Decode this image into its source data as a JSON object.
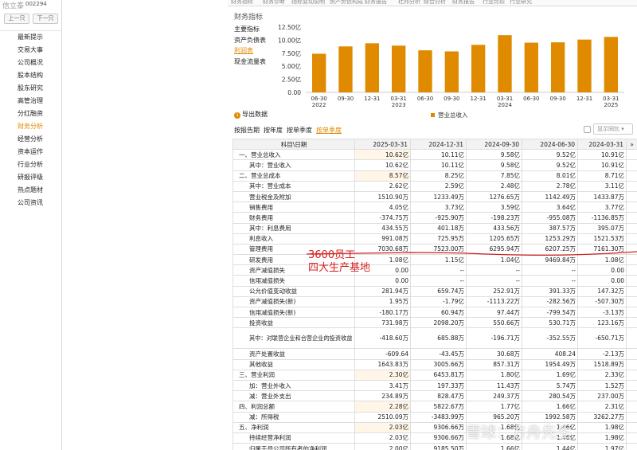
{
  "app": {
    "logo": "信立泰",
    "code": "002294",
    "prev": "上一只",
    "next": "下一只"
  },
  "menu": {
    "items": [
      "最新提示",
      "交易大事",
      "公司概况",
      "股本结构",
      "股东研究",
      "高管治理",
      "分红融资",
      "财务分析",
      "经营分析",
      "资本运作",
      "行业分析",
      "研报评级",
      "热点题材",
      "公司资讯"
    ],
    "active": 7
  },
  "top_tabs": [
    "财务指标",
    "财务诊断",
    "指标变动说明",
    "资产负债构成",
    "财务报告",
    "杜邦分析",
    "综合分析",
    "财务报告",
    "行业比较",
    "行业研究"
  ],
  "section_title": "财务指标",
  "subnav": {
    "items": [
      "主要指标",
      "资产负债表",
      "利润表",
      "现金流量表"
    ],
    "active": 2
  },
  "export_label": "导出数据",
  "views": {
    "items": [
      "按报告期",
      "按年度",
      "按单季度",
      "按单季度"
    ],
    "active": 3
  },
  "compare_label": "显示同比",
  "chart_data": {
    "type": "bar",
    "categories": [
      "06-30\n2022",
      "09-30",
      "12-31",
      "03-31\n2023",
      "06-30",
      "09-30",
      "12-31",
      "03-31\n2024",
      "06-30",
      "09-30",
      "12-31",
      "03-31\n2025"
    ],
    "series": [
      {
        "name": "营业总收入",
        "values": [
          7.4,
          8.8,
          9.4,
          8.95,
          8.05,
          7.85,
          9.1,
          10.95,
          9.52,
          9.58,
          10.11,
          10.62
        ],
        "color": "#e08a00"
      }
    ],
    "yticks": [
      "0.00",
      "2.50亿",
      "5.00亿",
      "7.50亿",
      "10.00亿",
      "12.50亿"
    ],
    "ylim": [
      0,
      12.5
    ]
  },
  "table": {
    "header": [
      "科目\\日期",
      "2025-03-31",
      "2024-12-31",
      "2024-09-30",
      "2024-06-30",
      "2024-03-31"
    ],
    "more": "»",
    "rows": [
      {
        "label": "一、营业总收入",
        "cells": [
          "10.62亿",
          "10.11亿",
          "9.58亿",
          "9.52亿",
          "10.91亿"
        ],
        "ind": 0,
        "hl": 1
      },
      {
        "label": "其中：营业收入",
        "cells": [
          "10.62亿",
          "10.11亿",
          "9.58亿",
          "9.52亿",
          "10.91亿"
        ],
        "ind": 1
      },
      {
        "label": "二、营业总成本",
        "cells": [
          "8.57亿",
          "8.25亿",
          "7.85亿",
          "8.01亿",
          "8.71亿"
        ],
        "ind": 0,
        "hl": 1
      },
      {
        "label": "其中：营业成本",
        "cells": [
          "2.62亿",
          "2.59亿",
          "2.48亿",
          "2.78亿",
          "3.11亿"
        ],
        "ind": 1
      },
      {
        "label": "营业税金及附加",
        "cells": [
          "1510.90万",
          "1233.49万",
          "1276.65万",
          "1142.49万",
          "1433.87万"
        ],
        "ind": 1
      },
      {
        "label": "销售费用",
        "cells": [
          "4.05亿",
          "3.73亿",
          "3.59亿",
          "3.64亿",
          "3.77亿"
        ],
        "ind": 1
      },
      {
        "label": "财务费用",
        "cells": [
          "-374.75万",
          "-925.90万",
          "-198.23万",
          "-955.08万",
          "-1136.85万"
        ],
        "ind": 1
      },
      {
        "label": "其中：利息费用",
        "cells": [
          "434.55万",
          "401.18万",
          "433.56万",
          "387.57万",
          "395.07万"
        ],
        "ind": 1
      },
      {
        "label": "利息收入",
        "cells": [
          "991.08万",
          "725.95万",
          "1205.65万",
          "1253.29万",
          "1521.53万"
        ],
        "ind": 1
      },
      {
        "label": "管理费用",
        "cells": [
          "7030.68万",
          "7523.00万",
          "6295.94万",
          "6207.25万",
          "7161.30万"
        ],
        "ind": 1
      },
      {
        "label": "研发费用",
        "cells": [
          "1.08亿",
          "1.15亿",
          "1.04亿",
          "9469.84万",
          "1.08亿"
        ],
        "ind": 1
      },
      {
        "label": "资产减值损失",
        "cells": [
          "0.00",
          "--",
          "--",
          "--",
          "0.00"
        ],
        "ind": 1
      },
      {
        "label": "信用减值损失",
        "cells": [
          "0.00",
          "--",
          "--",
          "--",
          "0.00"
        ],
        "ind": 1
      },
      {
        "label": "公允价值变动收益",
        "cells": [
          "281.94万",
          "659.74万",
          "252.91万",
          "391.33万",
          "147.32万"
        ],
        "ind": 1
      },
      {
        "label": "资产减值损失(新)",
        "cells": [
          "1.95万",
          "-1.79亿",
          "-1113.22万",
          "-282.56万",
          "-507.30万"
        ],
        "ind": 1
      },
      {
        "label": "信用减值损失(新)",
        "cells": [
          "-180.17万",
          "60.94万",
          "97.44万",
          "-799.54万",
          "-3.13万"
        ],
        "ind": 1
      },
      {
        "label": "投资收益",
        "cells": [
          "731.98万",
          "2098.20万",
          "550.66万",
          "530.71万",
          "123.16万"
        ],
        "ind": 1
      },
      {
        "label": "其中：对联营企业和合营企业的投资收益",
        "cells": [
          "-418.60万",
          "685.88万",
          "-196.71万",
          "-352.55万",
          "-650.71万"
        ],
        "ind": 1,
        "wrap": 1
      },
      {
        "label": "资产处置收益",
        "cells": [
          "-609.64",
          "-43.45万",
          "30.68万",
          "408.24",
          "-2.13万"
        ],
        "ind": 1
      },
      {
        "label": "其他收益",
        "cells": [
          "1643.83万",
          "3005.66万",
          "857.31万",
          "1954.49万",
          "1518.89万"
        ],
        "ind": 1
      },
      {
        "label": "三、营业利润",
        "cells": [
          "2.30亿",
          "6453.81万",
          "1.80亿",
          "1.69亿",
          "2.33亿"
        ],
        "ind": 0,
        "hl": 1
      },
      {
        "label": "加：营业外收入",
        "cells": [
          "3.41万",
          "197.33万",
          "11.43万",
          "5.74万",
          "1.52万"
        ],
        "ind": 1
      },
      {
        "label": "减：营业外支出",
        "cells": [
          "234.89万",
          "828.47万",
          "249.37万",
          "280.54万",
          "237.00万"
        ],
        "ind": 1
      },
      {
        "label": "四、利润总额",
        "cells": [
          "2.28亿",
          "5822.67万",
          "1.77亿",
          "1.66亿",
          "2.31亿"
        ],
        "ind": 0,
        "hl": 1
      },
      {
        "label": "减：所得税",
        "cells": [
          "2510.09万",
          "-3483.99万",
          "965.20万",
          "1992.58万",
          "3262.27万"
        ],
        "ind": 1
      },
      {
        "label": "五、净利润",
        "cells": [
          "2.03亿",
          "9306.66万",
          "1.68亿",
          "1.46亿",
          "1.98亿"
        ],
        "ind": 0,
        "hl": 1
      },
      {
        "label": "持续经营净利润",
        "cells": [
          "2.03亿",
          "9306.66万",
          "1.68亿",
          "1.46亿",
          "1.98亿"
        ],
        "ind": 1
      },
      {
        "label": "归属于母公司所有者的净利润",
        "cells": [
          "2.00亿",
          "9185.50万",
          "1.66亿",
          "1.44亿",
          "1.97亿"
        ],
        "ind": 1
      }
    ]
  },
  "annotation": {
    "line1": "3600员工",
    "line2": "四大生产基地",
    "color": "#d41f1f"
  },
  "watermark": "雪球：方舟先生"
}
